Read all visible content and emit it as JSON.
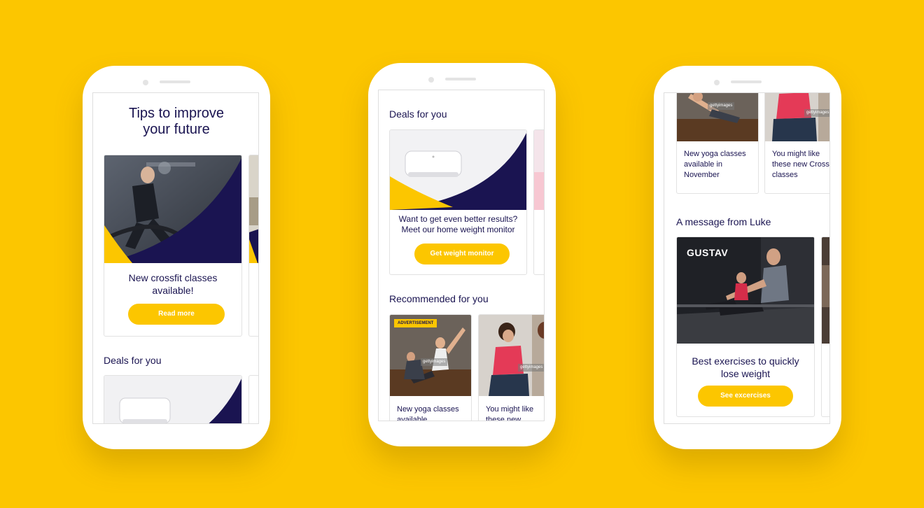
{
  "colors": {
    "background": "#fcc600",
    "navy": "#1a1451",
    "accent": "#fcc600"
  },
  "phone1": {
    "hero_title": "Tips to improve your future",
    "card": {
      "text": "New crossfit classes available!",
      "button": "Read more"
    },
    "deals_title": "Deals for you"
  },
  "phone2": {
    "deals_title": "Deals for you",
    "deal_card": {
      "text": "Want to get even better results? Meet our home weight monitor",
      "button": "Get weight monitor"
    },
    "recommended_title": "Recommended for you",
    "rec_cards": [
      {
        "badge": "ADVERTISEMENT",
        "watermark": "gettyimages",
        "text": "New yoga classes available"
      },
      {
        "watermark": "gettyimages",
        "text": "You might like these new"
      }
    ]
  },
  "phone3": {
    "top_cards": [
      {
        "watermark": "gettyimages",
        "text": "New yoga classes available in November"
      },
      {
        "watermark": "gettyimages",
        "text": "You might like these new Crossfit classes"
      }
    ],
    "message_title": "A message from Luke",
    "message_card": {
      "brand": "GUSTAV",
      "text": "Best exercises to quickly lose weight",
      "button": "See excercises"
    }
  }
}
